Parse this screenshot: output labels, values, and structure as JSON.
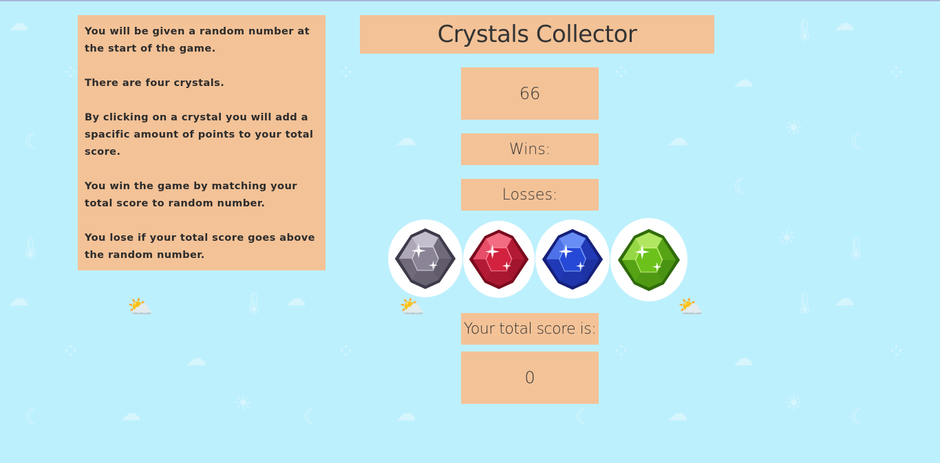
{
  "instructions": [
    "You will be given a random number at the start of the game.",
    "There are four crystals.",
    "By clicking on a crystal you will add a spacific amount of points to your total score.",
    "You win the game by matching your total score to random number.",
    "You lose if your total score goes above the random number."
  ],
  "title": "Crystals Collector",
  "target_number": "66",
  "wins_label": "Wins:",
  "losses_label": "Losses:",
  "total_label": "Your total score is:",
  "total_value": "0",
  "crystals": [
    {
      "name": "gray",
      "color": "#8a8496",
      "highlight": "#d7d3df",
      "dark": "#3f3a4a"
    },
    {
      "name": "red",
      "color": "#d2223f",
      "highlight": "#ff8598",
      "dark": "#7a0b1f"
    },
    {
      "name": "blue",
      "color": "#2548d6",
      "highlight": "#7fa4ff",
      "dark": "#16207a"
    },
    {
      "name": "green",
      "color": "#6cc21b",
      "highlight": "#c8f27a",
      "dark": "#2f6b0b"
    }
  ],
  "colors": {
    "background": "#bdf0fd",
    "panel": "#f3c297",
    "text": "#333333"
  }
}
